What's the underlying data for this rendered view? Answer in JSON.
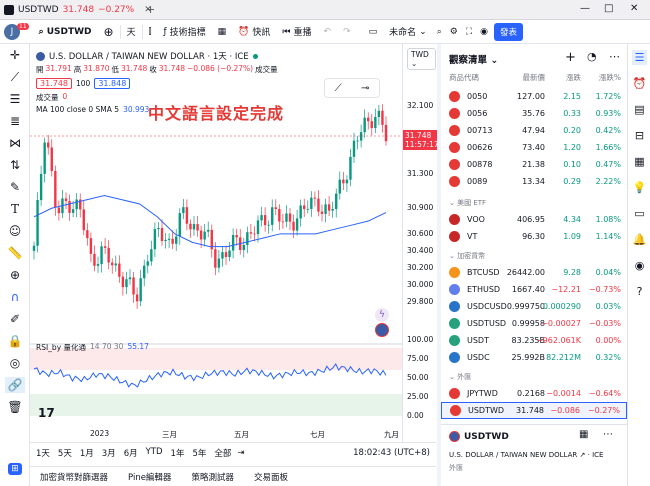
{
  "window": {
    "tab_title": "USDTWD",
    "tab_price": "31.748",
    "tab_change": "−0.27%"
  },
  "toolbar": {
    "symbol": "USDTWD",
    "interval": "天",
    "indicators": "技術指標",
    "quick": "快訊",
    "replay": "重播",
    "layout_name": "未命名",
    "publish": "發表",
    "avatar_letter": "J",
    "notif_count": "11"
  },
  "chart": {
    "title": "U.S. DOLLAR / TAIWAN NEW DOLLAR · 1天 · ICE",
    "ohlc": {
      "o_label": "開",
      "o": "31.791",
      "h_label": "高",
      "h": "31.870",
      "l_label": "低",
      "l": "31.748",
      "c_label": "收",
      "c": "31.748",
      "chg": "−0.086 (−0.27%)",
      "vol_label": "成交量"
    },
    "bid": "31.748",
    "spread": "100",
    "ask": "31.848",
    "volume_label": "成交量",
    "volume_value": "0",
    "ma_label": "MA 100 close 0 SMA 5",
    "ma_value": "30.993",
    "overlay_text": "中文語言設定完成",
    "rsi_label": "RSI_by 量化通",
    "rsi_params": "14 70 30",
    "rsi_value": "55.17",
    "currency": "TWD",
    "last_price": "31.748",
    "countdown": "11:57:17",
    "price_ticks": [
      "32.100",
      "31.700",
      "31.300",
      "30.900",
      "30.600",
      "30.400",
      "30.200",
      "30.000",
      "29.800"
    ],
    "rsi_ticks": [
      "100.00",
      "75.00",
      "50.00",
      "25.00",
      "0.00"
    ],
    "time_ticks": [
      "2023",
      "三月",
      "五月",
      "七月",
      "九月"
    ],
    "periods": [
      "1天",
      "5天",
      "1月",
      "3月",
      "6月",
      "YTD",
      "1年",
      "5年",
      "全部"
    ],
    "clock": "18:02:43 (UTC+8)",
    "panel_tabs": [
      "加密貨幣對篩選器",
      "Pine編輯器",
      "策略測試器",
      "交易面板"
    ]
  },
  "chart_data": {
    "type": "candlestick",
    "x_ticks": [
      "2023",
      "三月",
      "五月",
      "七月",
      "九月"
    ],
    "close_path": [
      30.4,
      31.9,
      30.8,
      31.0,
      30.9,
      30.3,
      30.4,
      30.2,
      30.1,
      29.8,
      30.4,
      30.6,
      30.5,
      30.8,
      30.7,
      30.6,
      30.3,
      30.4,
      30.5,
      30.6,
      30.7,
      30.9,
      30.7,
      30.8,
      30.9,
      31.0,
      30.8,
      31.2,
      31.5,
      31.9,
      32.0,
      31.75
    ],
    "ma": [
      30.8,
      30.9,
      30.95,
      31.0,
      31.05,
      31.0,
      30.95,
      30.8,
      30.6,
      30.5,
      30.45,
      30.45,
      30.5,
      30.55,
      30.6,
      30.6,
      30.6,
      30.65,
      30.7,
      30.75,
      30.85
    ],
    "rsi": [
      62,
      55,
      58,
      50,
      48,
      55,
      52,
      45,
      40,
      48,
      55,
      58,
      52,
      50,
      56,
      58,
      55,
      60,
      57,
      52,
      55,
      58,
      56,
      60,
      65,
      62,
      58,
      60,
      55
    ]
  },
  "watchlist": {
    "title": "觀察清單",
    "cols": [
      "商品代碼",
      "最新價",
      "漲跌",
      "漲跌%"
    ],
    "rows": [
      {
        "sym": "0050",
        "last": "127.00",
        "chg": "2.15",
        "pct": "1.72%",
        "color": "#e53935"
      },
      {
        "sym": "0056",
        "last": "35.76",
        "chg": "0.33",
        "pct": "0.93%",
        "color": "#e53935"
      },
      {
        "sym": "00713",
        "last": "47.94",
        "chg": "0.20",
        "pct": "0.42%",
        "color": "#e53935"
      },
      {
        "sym": "00626",
        "last": "73.40",
        "chg": "1.20",
        "pct": "1.66%",
        "color": "#e53935"
      },
      {
        "sym": "00878",
        "last": "21.38",
        "chg": "0.10",
        "pct": "0.47%",
        "color": "#e53935"
      },
      {
        "sym": "0089",
        "last": "13.34",
        "chg": "0.29",
        "pct": "2.22%",
        "color": "#e53935"
      }
    ],
    "section_us": "美國 ETF",
    "us_rows": [
      {
        "sym": "VOO",
        "last": "406.95",
        "chg": "4.34",
        "pct": "1.08%",
        "color": "#c62828"
      },
      {
        "sym": "VT",
        "last": "96.30",
        "chg": "1.09",
        "pct": "1.14%",
        "color": "#c62828"
      }
    ],
    "section_crypto": "加密貨幣",
    "crypto_rows": [
      {
        "sym": "BTCUSD",
        "last": "26442.00",
        "chg": "9.28",
        "pct": "0.04%",
        "dir": "up",
        "color": "#f7931a"
      },
      {
        "sym": "ETHUSD",
        "last": "1667.40",
        "chg": "−12.21",
        "pct": "−0.73%",
        "dir": "down",
        "color": "#627eea"
      },
      {
        "sym": "USDCUSD",
        "last": "0.999750",
        "chg": "0.000290",
        "pct": "0.03%",
        "dir": "up",
        "color": "#2775ca"
      },
      {
        "sym": "USDTUSD",
        "last": "0.99958",
        "chg": "−0.00027",
        "pct": "−0.03%",
        "dir": "down",
        "color": "#26a17b"
      },
      {
        "sym": "USDT",
        "last": "83.235B",
        "chg": "−962.061K",
        "pct": "0.00%",
        "dir": "down",
        "color": "#26a17b"
      },
      {
        "sym": "USDC",
        "last": "25.992B",
        "chg": "82.212M",
        "pct": "0.32%",
        "dir": "up",
        "color": "#2775ca"
      }
    ],
    "section_fx": "外匯",
    "fx_rows": [
      {
        "sym": "JPYTWD",
        "last": "0.2168",
        "chg": "−0.0014",
        "pct": "−0.64%",
        "dir": "down",
        "color": "#e53935"
      },
      {
        "sym": "USDTWD",
        "last": "31.748",
        "chg": "−0.086",
        "pct": "−0.27%",
        "dir": "down",
        "color": "#e53935"
      }
    ],
    "detail_sym": "USDTWD",
    "detail_name": "U.S. DOLLAR / TAIWAN NEW DOLLAR",
    "detail_exchange": "ICE",
    "detail_type": "外匯"
  },
  "colors": {
    "up": "#089981",
    "down": "#f23645",
    "accent": "#2962ff",
    "ma": "#2962ff",
    "rsi": "#2962ff"
  }
}
